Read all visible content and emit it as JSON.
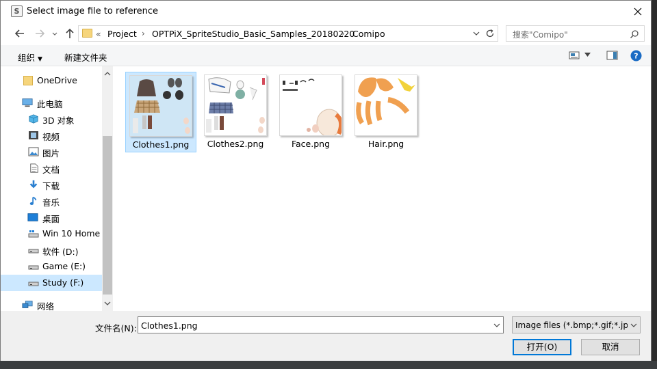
{
  "window": {
    "app_icon_letter": "S",
    "title": "Select image file to reference"
  },
  "addressbar": {
    "overflow": "«",
    "crumbs": [
      "Project",
      "OPTPiX_SpriteStudio_Basic_Samples_20180220",
      "Comipo"
    ],
    "separator": "›"
  },
  "search": {
    "placeholder": "搜索\"Comipo\""
  },
  "toolbar": {
    "organize_label": "组织",
    "new_folder_label": "新建文件夹"
  },
  "navpane": {
    "items": [
      {
        "label": "OneDrive",
        "icon": "folder-icon"
      },
      {
        "label": "此电脑",
        "icon": "computer-icon"
      },
      {
        "label": "3D 对象",
        "icon": "3d-objects-icon"
      },
      {
        "label": "视频",
        "icon": "video-icon"
      },
      {
        "label": "图片",
        "icon": "pictures-icon"
      },
      {
        "label": "文档",
        "icon": "documents-icon"
      },
      {
        "label": "下载",
        "icon": "download-icon"
      },
      {
        "label": "音乐",
        "icon": "music-icon"
      },
      {
        "label": "桌面",
        "icon": "desktop-icon"
      },
      {
        "label": "Win 10 Home ›",
        "icon": "drive-icon"
      },
      {
        "label": "软件 (D:)",
        "icon": "drive-icon"
      },
      {
        "label": "Game (E:)",
        "icon": "drive-icon"
      },
      {
        "label": "Study (F:)",
        "icon": "drive-icon"
      },
      {
        "label": "网络",
        "icon": "network-icon"
      }
    ],
    "selected_index": 12
  },
  "files": [
    {
      "name": "Clothes1.png",
      "selected": true
    },
    {
      "name": "Clothes2.png",
      "selected": false
    },
    {
      "name": "Face.png",
      "selected": false
    },
    {
      "name": "Hair.png",
      "selected": false
    }
  ],
  "bottom": {
    "filename_label": "文件名(N):",
    "filename_value": "Clothes1.png",
    "filter_value": "Image files (*.bmp;*.gif;*.jpg;",
    "open_label": "打开(O)",
    "cancel_label": "取消"
  },
  "colors": {
    "selection": "#cce8ff",
    "selection_border": "#99d1ff",
    "primary_border": "#0078d7",
    "hair": "#f0a050"
  }
}
